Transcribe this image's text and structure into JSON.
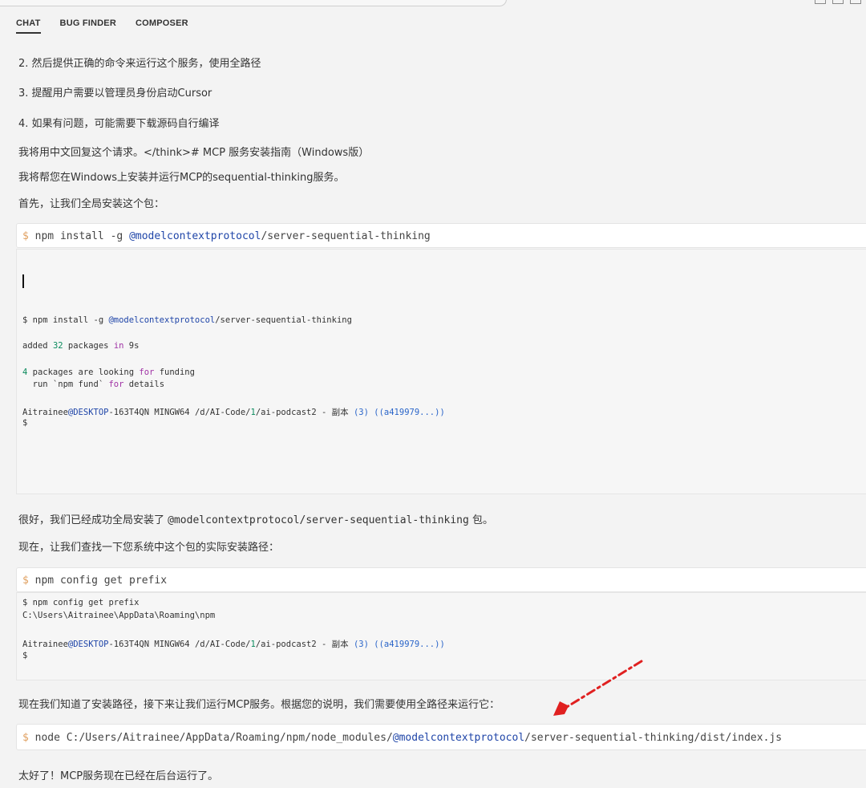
{
  "tabs": [
    {
      "label": "CHAT",
      "active": true
    },
    {
      "label": "BUG FINDER",
      "active": false
    },
    {
      "label": "COMPOSER",
      "active": false
    }
  ],
  "messages": {
    "step2": "2. 然后提供正确的命令来运行这个服务，使用全路径",
    "step3": "3. 提醒用户需要以管理员身份启动Cursor",
    "step4": "4. 如果有问题，可能需要下载源码自行编译",
    "reply_intro": "我将用中文回复这个请求。</think># MCP 服务安装指南（Windows版）",
    "help_line": "我将帮您在Windows上安装并运行MCP的sequential-thinking服务。",
    "first_line": "首先，让我们全局安装这个包：",
    "success_prefix": "很好，我们已经成功全局安装了",
    "success_pkg": "@modelcontextprotocol/server-sequential-thinking",
    "success_suffix": "包。",
    "find_path": "现在，让我们查找一下您系统中这个包的实际安装路径：",
    "know_path": "现在我们知道了安装路径，接下来让我们运行MCP服务。根据您的说明，我们需要使用全路径来运行它：",
    "final": "太好了！MCP服务现在已经在后台运行了。"
  },
  "commands": {
    "dollar": "$",
    "install_pre": "npm install -g ",
    "install_scope": "@modelcontextprotocol",
    "install_post": "/server-sequential-thinking",
    "prefix": "npm config get prefix",
    "node_pre": "node C:/Users/Aitrainee/AppData/Roaming/npm/node_modules/",
    "node_scope": "@modelcontextprotocol",
    "node_post": "/server-sequential-thinking/dist/index.js"
  },
  "terminal1": {
    "cmd_pre": "$ npm install -g ",
    "cmd_scope": "@modelcontextprotocol",
    "cmd_post": "/server-sequential-thinking",
    "added_pre": "added ",
    "added_num": "32",
    "added_mid": " packages ",
    "added_in": "in",
    "added_time": " 9s",
    "funding_num": "4",
    "funding_mid": " packages are looking ",
    "funding_for": "for",
    "funding_post": " funding",
    "run_pre": "  run `npm fund` ",
    "run_for": "for",
    "run_post": " details",
    "prompt_user": "Aitrainee",
    "prompt_host": "@DESKTOP",
    "prompt_mid1": "-163T4QN MINGW64 /d/AI-Code/",
    "prompt_num": "1",
    "prompt_mid2": "/ai-podcast2 - 副本 ",
    "prompt_paren": "(3)",
    "prompt_branch": " ((a419979...))",
    "prompt_dollar": "$"
  },
  "terminal2": {
    "cmd": "$ npm config get prefix",
    "output": "C:\\Users\\Aitrainee\\AppData\\Roaming\\npm",
    "prompt_user": "Aitrainee",
    "prompt_host": "@DESKTOP",
    "prompt_mid1": "-163T4QN MINGW64 /d/AI-Code/",
    "prompt_num": "1",
    "prompt_mid2": "/ai-podcast2 - 副本 ",
    "prompt_paren": "(3)",
    "prompt_branch": " ((a419979...))",
    "prompt_dollar": "$"
  },
  "colors": {
    "accent_blue": "#1f45a8",
    "number_green": "#0a8a5c",
    "keyword_purple": "#a033a5",
    "arrow_red": "#e02020"
  }
}
